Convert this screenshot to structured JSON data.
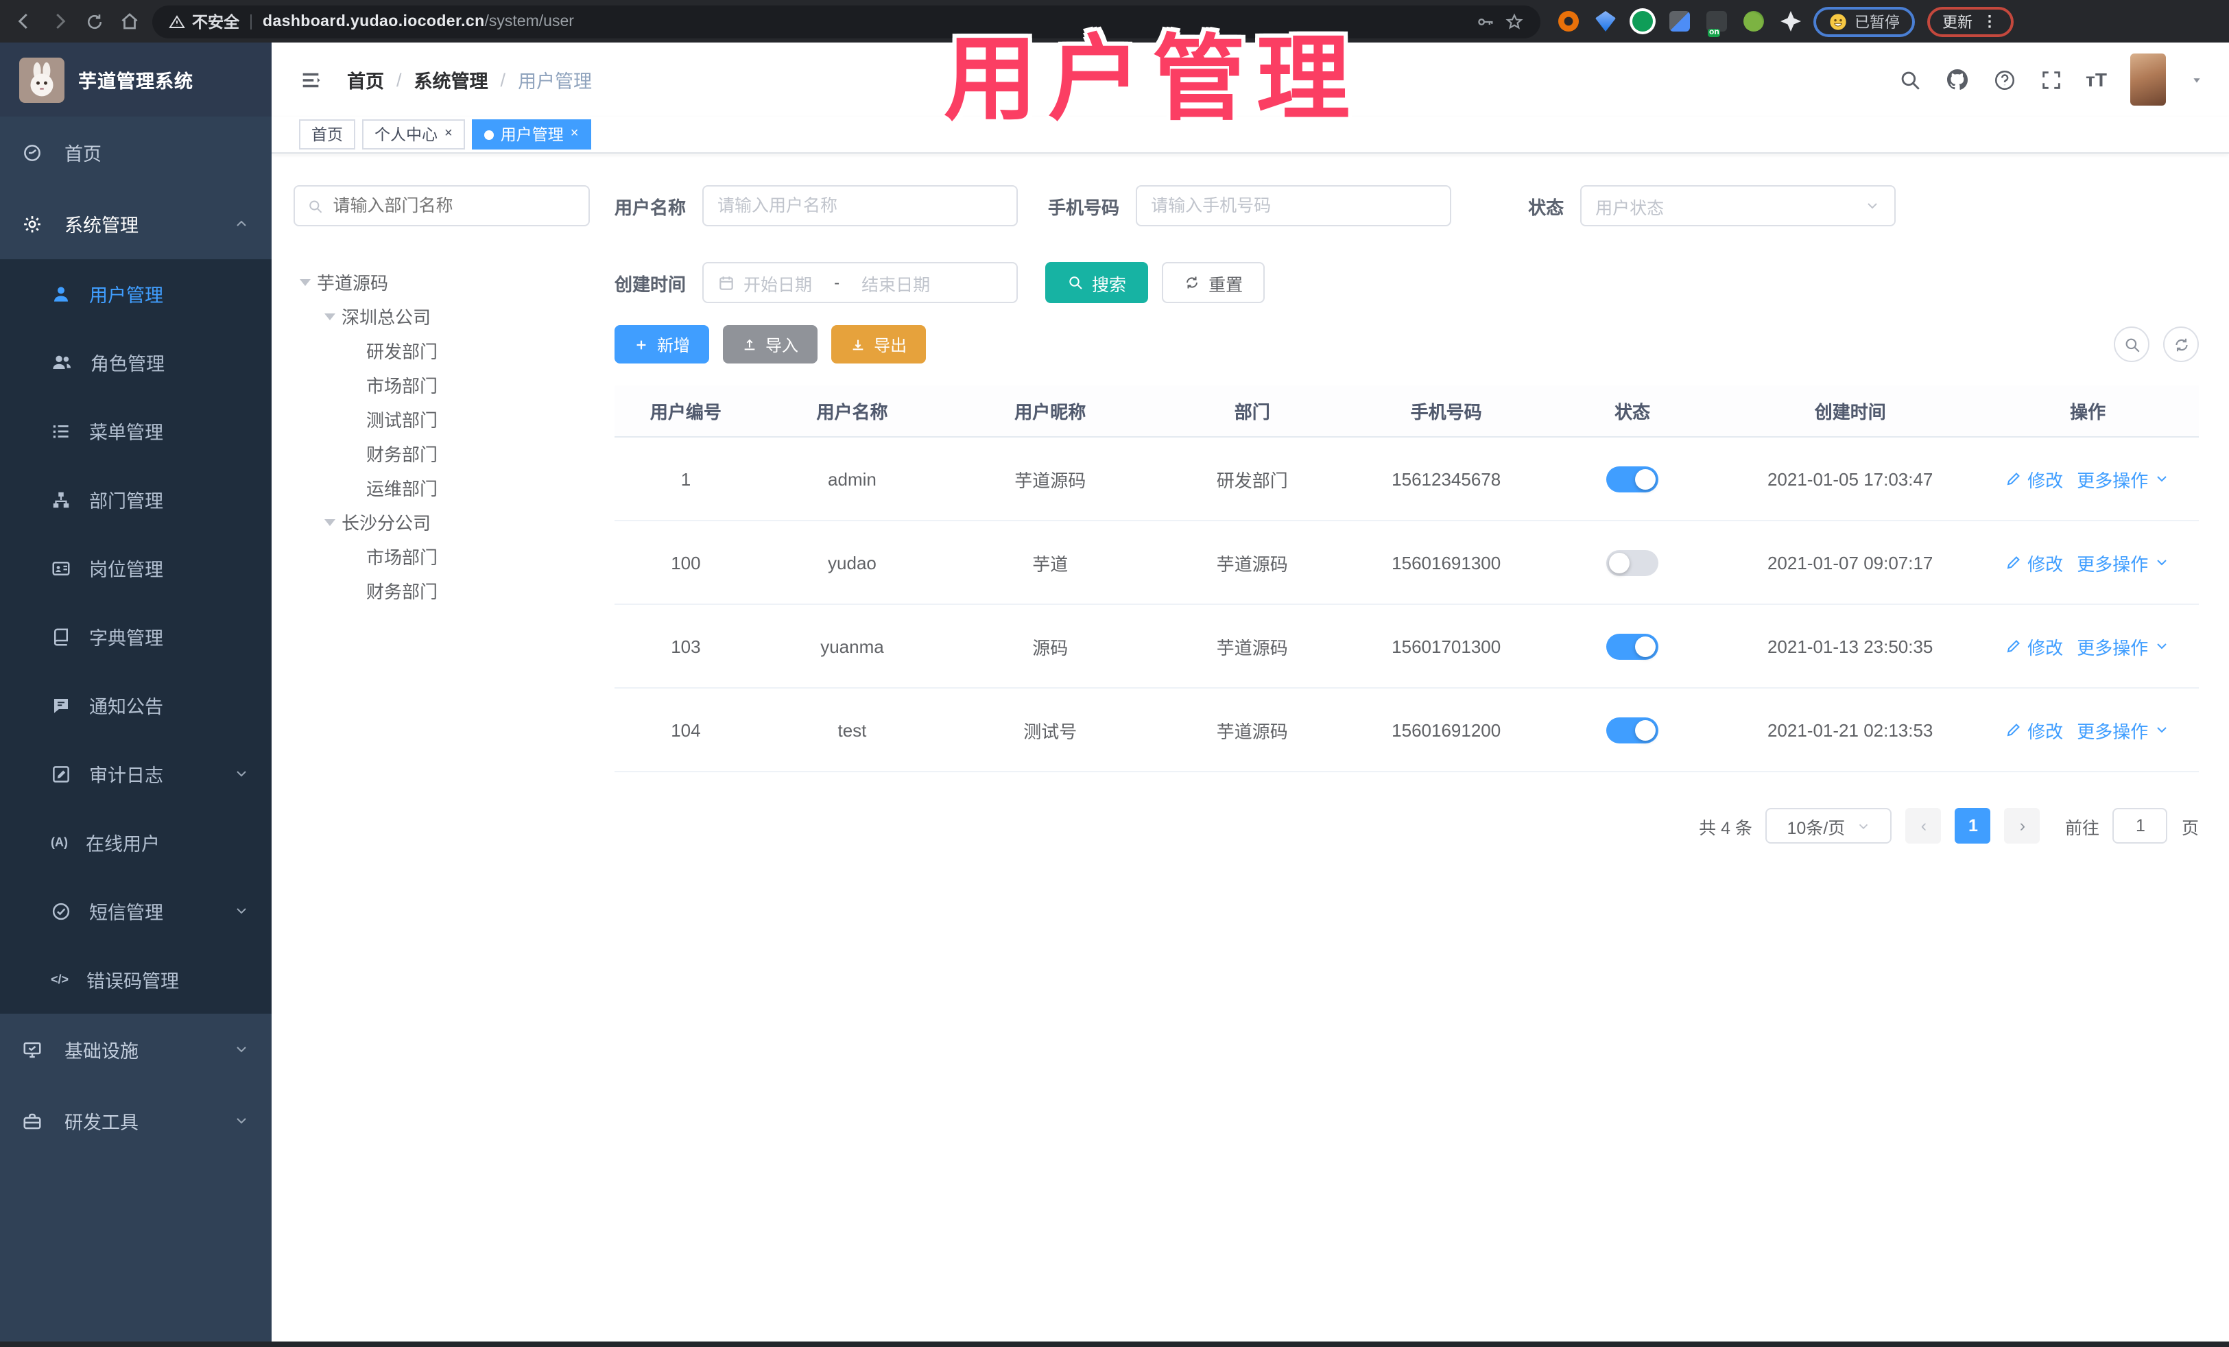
{
  "browser": {
    "security_label": "不安全",
    "url_host": "dashboard.yudao.iocoder.cn",
    "url_path": "/system/user",
    "paused_label": "已暂停",
    "update_label": "更新"
  },
  "header": {
    "logo_title": "芋道管理系统",
    "breadcrumb": [
      "首页",
      "系统管理",
      "用户管理"
    ],
    "separator": "/",
    "font_size_icon_label": "тT"
  },
  "annotation": {
    "text": "用户管理",
    "color": "#fb3e63"
  },
  "tags": [
    {
      "label": "首页"
    },
    {
      "label": "个人中心",
      "close": "×"
    },
    {
      "label": "用户管理",
      "close": "×"
    }
  ],
  "sidebar": {
    "items": [
      {
        "label": "首页",
        "icon": "dashboard-icon"
      },
      {
        "label": "系统管理",
        "icon": "gear-icon"
      },
      {
        "label": "用户管理",
        "icon": "user-icon"
      },
      {
        "label": "角色管理",
        "icon": "roles-icon"
      },
      {
        "label": "菜单管理",
        "icon": "menu-list-icon"
      },
      {
        "label": "部门管理",
        "icon": "org-tree-icon"
      },
      {
        "label": "岗位管理",
        "icon": "id-card-icon"
      },
      {
        "label": "字典管理",
        "icon": "dictionary-icon"
      },
      {
        "label": "通知公告",
        "icon": "announcement-icon"
      },
      {
        "label": "审计日志",
        "icon": "audit-log-icon"
      },
      {
        "label": "在线用户",
        "icon": "online-user-icon",
        "icon_text": "(A)"
      },
      {
        "label": "短信管理",
        "icon": "sms-check-icon"
      },
      {
        "label": "错误码管理",
        "icon": "error-code-icon",
        "icon_text": "</>"
      },
      {
        "label": "基础设施",
        "icon": "infrastructure-icon"
      },
      {
        "label": "研发工具",
        "icon": "dev-tools-icon"
      }
    ]
  },
  "dept_panel": {
    "search_placeholder": "请输入部门名称",
    "tree": [
      {
        "label": "芋道源码",
        "level": 0
      },
      {
        "label": "深圳总公司",
        "level": 1
      },
      {
        "label": "研发部门",
        "level": 2
      },
      {
        "label": "市场部门",
        "level": 2
      },
      {
        "label": "测试部门",
        "level": 2
      },
      {
        "label": "财务部门",
        "level": 2
      },
      {
        "label": "运维部门",
        "level": 2
      },
      {
        "label": "长沙分公司",
        "level": 1
      },
      {
        "label": "市场部门",
        "level": 2
      },
      {
        "label": "财务部门",
        "level": 2
      }
    ]
  },
  "filters": {
    "username_label": "用户名称",
    "username_placeholder": "请输入用户名称",
    "mobile_label": "手机号码",
    "mobile_placeholder": "请输入手机号码",
    "status_label": "状态",
    "status_placeholder": "用户状态",
    "created_label": "创建时间",
    "start_placeholder": "开始日期",
    "range_separator": "-",
    "end_placeholder": "结束日期",
    "search_label": "搜索",
    "reset_label": "重置"
  },
  "toolbar": {
    "add_label": "新增",
    "import_label": "导入",
    "export_label": "导出"
  },
  "table": {
    "columns": [
      "用户编号",
      "用户名称",
      "用户昵称",
      "部门",
      "手机号码",
      "状态",
      "创建时间",
      "操作"
    ],
    "edit_label": "修改",
    "more_label": "更多操作",
    "rows": [
      {
        "id": "1",
        "username": "admin",
        "nickname": "芋道源码",
        "dept": "研发部门",
        "mobile": "15612345678",
        "status": true,
        "created": "2021-01-05 17:03:47"
      },
      {
        "id": "100",
        "username": "yudao",
        "nickname": "芋道",
        "dept": "芋道源码",
        "mobile": "15601691300",
        "status": false,
        "created": "2021-01-07 09:07:17"
      },
      {
        "id": "103",
        "username": "yuanma",
        "nickname": "源码",
        "dept": "芋道源码",
        "mobile": "15601701300",
        "status": true,
        "created": "2021-01-13 23:50:35"
      },
      {
        "id": "104",
        "username": "test",
        "nickname": "测试号",
        "dept": "芋道源码",
        "mobile": "15601691200",
        "status": true,
        "created": "2021-01-21 02:13:53"
      }
    ]
  },
  "pagination": {
    "total": "共 4 条",
    "page_size": "10条/页",
    "page": "1",
    "goto_label": "前往",
    "goto_value": "1",
    "page_unit": "页"
  },
  "colors": {
    "primary": "#409eff",
    "search_teal": "#17b3a3",
    "warning": "#e6a23c",
    "info_grey": "#909399",
    "sidebar_bg": "#304156",
    "submenu_bg": "#1f2d3d",
    "annotation_pink": "#fb3e63"
  }
}
